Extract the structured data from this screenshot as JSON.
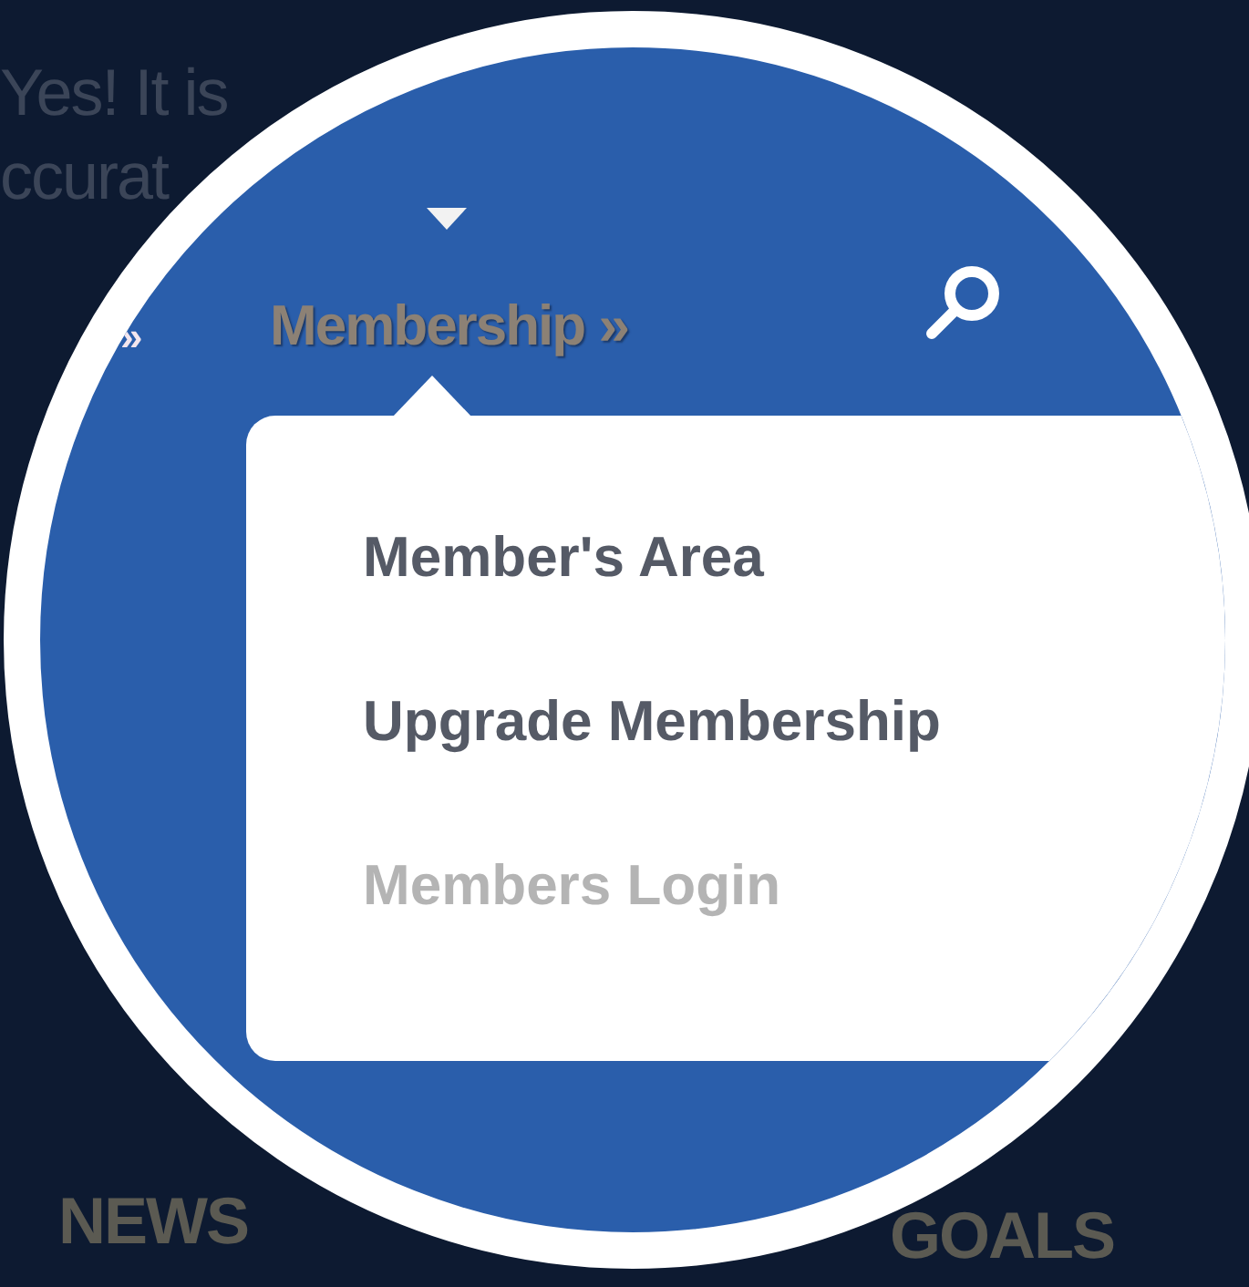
{
  "background": {
    "lines": [
      "Yes! It is",
      "ccurat"
    ],
    "bottom_links": [
      "NEWS",
      "GOALS"
    ]
  },
  "magnifier": {
    "nav": {
      "separator": "»",
      "item": {
        "label": "Membership »",
        "expanded": true
      }
    },
    "dropdown": {
      "items": [
        {
          "label": "Member's Area",
          "disabled": false
        },
        {
          "label": "Upgrade Membership",
          "disabled": false
        },
        {
          "label": "Members Login",
          "disabled": true
        }
      ]
    }
  }
}
